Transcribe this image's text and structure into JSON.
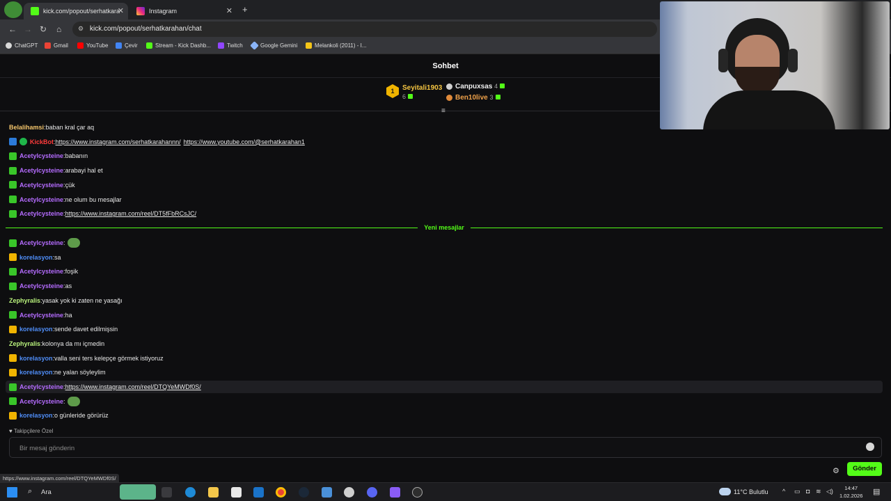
{
  "browser": {
    "tabs": [
      {
        "label": "kick.com/popout/serhatkarahan",
        "active": true
      },
      {
        "label": "Instagram",
        "active": false
      }
    ],
    "new_tab": "+",
    "url": "kick.com/popout/serhatkarahan/chat",
    "bookmarks": [
      "ChatGPT",
      "Gmail",
      "YouTube",
      "Çevir",
      "Stream - Kick Dashb...",
      "Twitch",
      "Google Gemini",
      "Melankoli (2011) - I..."
    ],
    "status_url": "https://www.instagram.com/reel/DTQYeMWDf0S/"
  },
  "chat": {
    "title": "Sohbet",
    "gifters": [
      {
        "rank": "1",
        "name": "Seyitali1903",
        "count": "6"
      },
      {
        "name": "Canpuxsas",
        "count": "4"
      },
      {
        "name": "Ben10live",
        "count": "3"
      }
    ],
    "messages_before": [
      {
        "user": "Belalihamsi",
        "text": "baban kral çar aq",
        "badge": "none",
        "color": "#f5c66c"
      },
      {
        "user": "KickBot",
        "text": "",
        "links": [
          "https://www.instagram.com/serhatkarahannn/",
          "https://www.youtube.com/@serhatkarahan1"
        ],
        "badge": "bot",
        "color": "#ff3b3b"
      },
      {
        "user": "Acetylcysteine",
        "text": "babanın",
        "badge": "sub",
        "color": "#b56cff"
      },
      {
        "user": "Acetylcysteine",
        "text": "arabayi hal et",
        "badge": "sub",
        "color": "#b56cff"
      },
      {
        "user": "Acetylcysteine",
        "text": "çük",
        "badge": "sub",
        "color": "#b56cff"
      },
      {
        "user": "Acetylcysteine",
        "text": "ne olum bu mesajlar",
        "badge": "sub",
        "color": "#b56cff"
      },
      {
        "user": "Acetylcysteine",
        "link": "https://www.instagram.com/reel/DT5fFbRCsJC/",
        "badge": "sub",
        "color": "#b56cff"
      }
    ],
    "new_messages_label": "Yeni mesajlar",
    "messages_after": [
      {
        "user": "Acetylcysteine",
        "emote": true,
        "badge": "sub",
        "color": "#b56cff"
      },
      {
        "user": "korelasyon",
        "text": "sa",
        "badge": "crown",
        "color": "#4f8df7"
      },
      {
        "user": "Acetylcysteine",
        "text": "foşik",
        "badge": "sub",
        "color": "#b56cff"
      },
      {
        "user": "Acetylcysteine",
        "text": "as",
        "badge": "sub",
        "color": "#b56cff"
      },
      {
        "user": "Zephyralis",
        "text": "yasak yok ki zaten ne yasağı",
        "badge": "none",
        "color": "#b9f27c"
      },
      {
        "user": "Acetylcysteine",
        "text": "ha",
        "badge": "sub",
        "color": "#b56cff"
      },
      {
        "user": "korelasyon",
        "text": "sende davet edilmişsin",
        "badge": "crown",
        "color": "#4f8df7"
      },
      {
        "user": "Zephyralis",
        "text": "kolonya da mı içmedin",
        "badge": "none",
        "color": "#b9f27c"
      },
      {
        "user": "korelasyon",
        "text": "valla seni ters kelepçe görmek istiyoruz",
        "badge": "crown",
        "color": "#4f8df7"
      },
      {
        "user": "korelasyon",
        "text": "ne yalan söyleylim",
        "badge": "crown",
        "color": "#4f8df7"
      },
      {
        "user": "Acetylcysteine",
        "link": "https://www.instagram.com/reel/DTQYeMWDf0S/",
        "badge": "sub",
        "color": "#b56cff",
        "highlight": true
      },
      {
        "user": "Acetylcysteine",
        "emote": true,
        "badge": "sub",
        "color": "#b56cff"
      },
      {
        "user": "korelasyon",
        "text": "o günleride görürüz",
        "badge": "crown",
        "color": "#4f8df7"
      }
    ],
    "followers_only": "Takipçilere Özel",
    "input_placeholder": "Bir mesaj gönderin",
    "send_label": "Gönder"
  },
  "taskbar": {
    "search_label": "Ara",
    "weather": "11°C  Bulutlu",
    "time": "14:47",
    "date": "1.02.2026"
  },
  "colors": {
    "kick_green": "#53fc18",
    "background": "#0e0e10"
  }
}
